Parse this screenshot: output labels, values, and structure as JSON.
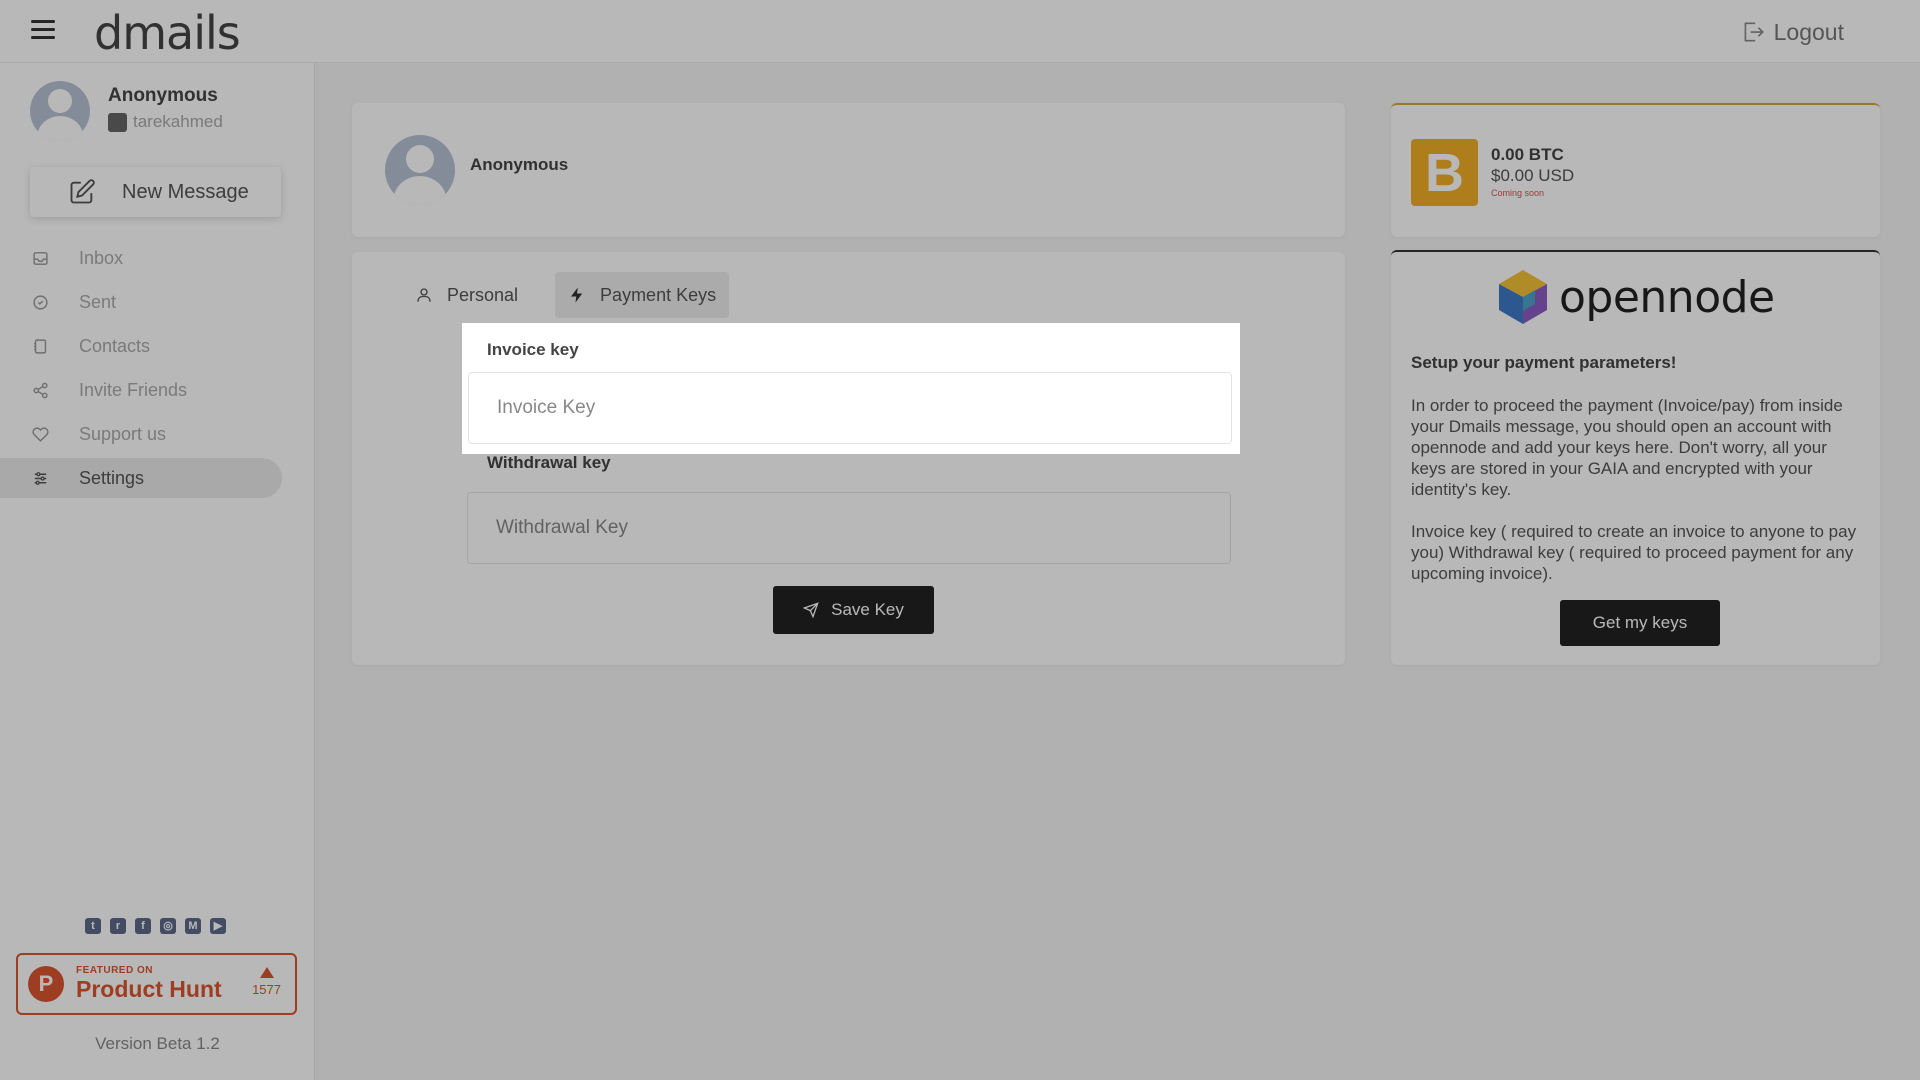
{
  "app": {
    "logo": "dmails",
    "logout_label": "Logout"
  },
  "sidebar": {
    "user_name": "Anonymous",
    "user_handle": "tarekahmed",
    "new_message_label": "New Message",
    "items": [
      {
        "label": "Inbox",
        "icon": "inbox-icon"
      },
      {
        "label": "Sent",
        "icon": "sent-icon"
      },
      {
        "label": "Contacts",
        "icon": "contacts-icon"
      },
      {
        "label": "Invite Friends",
        "icon": "share-icon"
      },
      {
        "label": "Support us",
        "icon": "heart-icon"
      },
      {
        "label": "Settings",
        "icon": "sliders-icon",
        "active": true
      }
    ],
    "social": [
      "twitter-icon",
      "reddit-icon",
      "facebook-icon",
      "instagram-icon",
      "medium-icon",
      "youtube-icon"
    ],
    "product_hunt": {
      "featured": "FEATURED ON",
      "name": "Product Hunt",
      "votes": "1577"
    },
    "version": "Version Beta 1.2"
  },
  "profile_card": {
    "name": "Anonymous"
  },
  "settings": {
    "tabs": [
      {
        "label": "Personal",
        "icon": "user-icon"
      },
      {
        "label": "Payment Keys",
        "icon": "bolt-icon",
        "active": true
      }
    ],
    "invoice_label": "Invoice key",
    "invoice_placeholder": "Invoice Key",
    "withdrawal_label": "Withdrawal key",
    "withdrawal_placeholder": "Withdrawal Key",
    "save_label": "Save Key"
  },
  "btc_card": {
    "btc": "0.00 BTC",
    "usd": "$0.00 USD",
    "note": "Coming soon",
    "icon": "bitcoin-icon",
    "accent": "#f2ae27"
  },
  "opennode_card": {
    "brand": "opennode",
    "title": "Setup your payment parameters!",
    "paragraph1": "In order to proceed the payment (Invoice/pay) from inside your Dmails message, you should open an account with opennode and add your keys here. Don't worry, all your keys are stored in your GAIA and encrypted with your identity's key.",
    "paragraph2": "Invoice key ( required to create an invoice to anyone to pay you) Withdrawal key ( required to proceed payment for any upcoming invoice).",
    "button_label": "Get my keys"
  }
}
